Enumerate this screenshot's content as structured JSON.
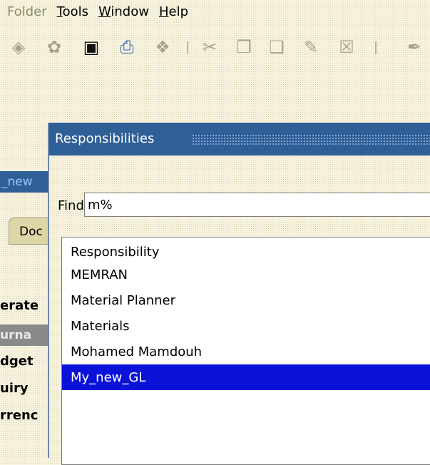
{
  "menubar": {
    "items": [
      {
        "label": "Folder",
        "mnemonic": "",
        "enabled": false
      },
      {
        "label": "Tools",
        "mnemonic": "T"
      },
      {
        "label": "Window",
        "mnemonic": "W"
      },
      {
        "label": "Help",
        "mnemonic": "H"
      }
    ]
  },
  "toolbar": {
    "icons": [
      "open-icon",
      "navigate-icon",
      "save-icon",
      "print-icon",
      "close-form-icon",
      "cut-icon",
      "copy-icon",
      "paste-icon",
      "edit-field-icon",
      "clear-record-icon",
      "attachment-icon"
    ]
  },
  "background_window": {
    "title_fragment": "_new",
    "tab_fragment": "Doc",
    "lines": [
      "erate",
      "dget",
      "uiry",
      "rrenc"
    ],
    "bar_fragment": "urna"
  },
  "dialog": {
    "title": "Responsibilities",
    "find_label": "Find",
    "find_value": "m%",
    "list_header": "Responsibility",
    "rows": [
      "MEMRAN",
      "Material Planner",
      "Materials",
      "Mohamed Mamdouh",
      "My_new_GL"
    ],
    "selected_index": 4
  },
  "colors": {
    "titlebar": "#2f5f97",
    "selection": "#0a12d8",
    "background": "#f7f3df",
    "tab": "#ddd6a7"
  }
}
